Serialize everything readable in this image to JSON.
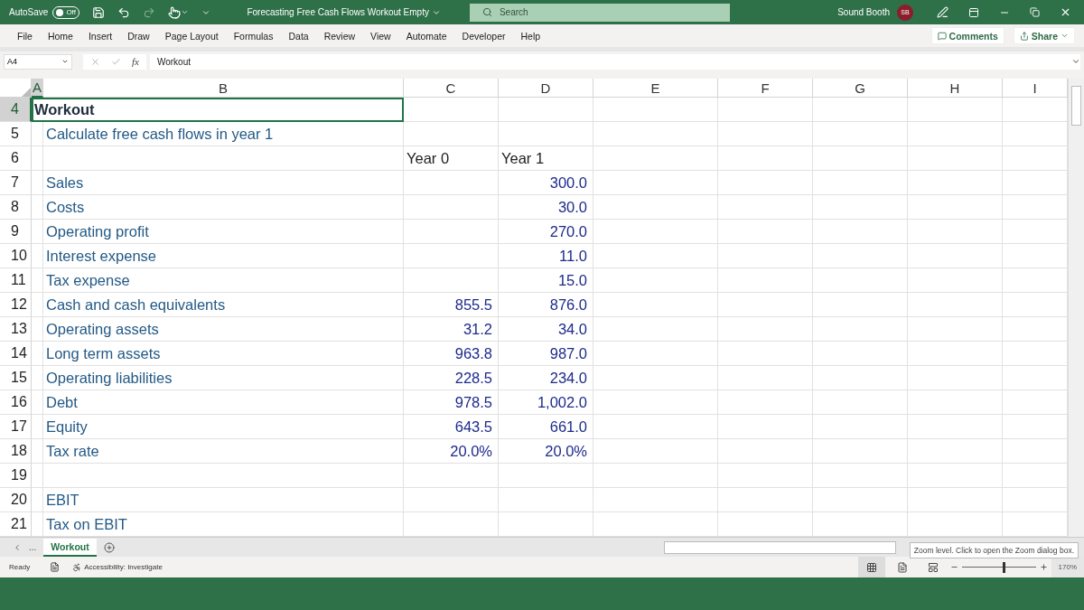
{
  "title_bar": {
    "autosave_label": "AutoSave",
    "autosave": {
      "on": false,
      "label": "Off"
    },
    "document_title": "Forecasting Free Cash Flows Workout Empty",
    "search_placeholder": "Search",
    "user_name": "Sound Booth",
    "user_initials": "SB"
  },
  "ribbon_tabs": [
    "File",
    "Home",
    "Insert",
    "Draw",
    "Page Layout",
    "Formulas",
    "Data",
    "Review",
    "View",
    "Automate",
    "Developer",
    "Help"
  ],
  "ribbon_buttons": {
    "comments": "Comments",
    "share": "Share"
  },
  "formula_bar": {
    "name_box": "A4",
    "fx": "fx",
    "value": "Workout"
  },
  "columns": [
    {
      "label": "A",
      "selected": true
    },
    {
      "label": "B",
      "selected": false
    },
    {
      "label": "C",
      "selected": false
    },
    {
      "label": "D",
      "selected": false
    },
    {
      "label": "E",
      "selected": false
    },
    {
      "label": "F",
      "selected": false
    },
    {
      "label": "G",
      "selected": false
    },
    {
      "label": "H",
      "selected": false
    },
    {
      "label": "I",
      "selected": false
    }
  ],
  "rows": [
    {
      "number": "4",
      "selected": true,
      "a": {
        "kind": "heading",
        "text": "Workout",
        "selected": true
      }
    },
    {
      "number": "5",
      "selected": false,
      "b": {
        "kind": "text",
        "text": "Calculate free cash flows in year 1",
        "selected": false
      }
    },
    {
      "number": "6",
      "selected": false,
      "c": {
        "kind": "plain",
        "text": "Year 0",
        "selected": false
      },
      "d": {
        "kind": "plain",
        "text": "Year 1",
        "selected": false
      }
    },
    {
      "number": "7",
      "selected": false,
      "b": {
        "kind": "text",
        "text": "Sales",
        "selected": false
      },
      "d": {
        "kind": "number",
        "text": "300.0",
        "selected": false
      }
    },
    {
      "number": "8",
      "selected": false,
      "b": {
        "kind": "text",
        "text": "Costs",
        "selected": false
      },
      "d": {
        "kind": "number",
        "text": "30.0",
        "selected": false
      }
    },
    {
      "number": "9",
      "selected": false,
      "b": {
        "kind": "text",
        "text": "Operating profit",
        "selected": false
      },
      "d": {
        "kind": "number",
        "text": "270.0",
        "selected": false
      }
    },
    {
      "number": "10",
      "selected": false,
      "b": {
        "kind": "text",
        "text": "Interest expense",
        "selected": false
      },
      "d": {
        "kind": "number",
        "text": "11.0",
        "selected": false
      }
    },
    {
      "number": "11",
      "selected": false,
      "b": {
        "kind": "text",
        "text": "Tax expense",
        "selected": false
      },
      "d": {
        "kind": "number",
        "text": "15.0",
        "selected": false
      }
    },
    {
      "number": "12",
      "selected": false,
      "b": {
        "kind": "text",
        "text": "Cash and cash equivalents",
        "selected": false
      },
      "c": {
        "kind": "number",
        "text": "855.5",
        "selected": false
      },
      "d": {
        "kind": "number",
        "text": "876.0",
        "selected": false
      }
    },
    {
      "number": "13",
      "selected": false,
      "b": {
        "kind": "text",
        "text": "Operating assets",
        "selected": false
      },
      "c": {
        "kind": "number",
        "text": "31.2",
        "selected": false
      },
      "d": {
        "kind": "number",
        "text": "34.0",
        "selected": false
      }
    },
    {
      "number": "14",
      "selected": false,
      "b": {
        "kind": "text",
        "text": "Long term assets",
        "selected": false
      },
      "c": {
        "kind": "number",
        "text": "963.8",
        "selected": false
      },
      "d": {
        "kind": "number",
        "text": "987.0",
        "selected": false
      }
    },
    {
      "number": "15",
      "selected": false,
      "b": {
        "kind": "text",
        "text": "Operating liabilities",
        "selected": false
      },
      "c": {
        "kind": "number",
        "text": "228.5",
        "selected": false
      },
      "d": {
        "kind": "number",
        "text": "234.0",
        "selected": false
      }
    },
    {
      "number": "16",
      "selected": false,
      "b": {
        "kind": "text",
        "text": "Debt",
        "selected": false
      },
      "c": {
        "kind": "number",
        "text": "978.5",
        "selected": false
      },
      "d": {
        "kind": "number",
        "text": "1,002.0",
        "selected": false
      }
    },
    {
      "number": "17",
      "selected": false,
      "b": {
        "kind": "text",
        "text": "Equity",
        "selected": false
      },
      "c": {
        "kind": "number",
        "text": "643.5",
        "selected": false
      },
      "d": {
        "kind": "number",
        "text": "661.0",
        "selected": false
      }
    },
    {
      "number": "18",
      "selected": false,
      "b": {
        "kind": "text",
        "text": "Tax rate",
        "selected": false
      },
      "c": {
        "kind": "number",
        "text": "20.0%",
        "selected": false
      },
      "d": {
        "kind": "number",
        "text": "20.0%",
        "selected": false
      }
    },
    {
      "number": "19",
      "selected": false
    },
    {
      "number": "20",
      "selected": false,
      "b": {
        "kind": "text",
        "text": "EBIT",
        "selected": false
      }
    },
    {
      "number": "21",
      "selected": false,
      "b": {
        "kind": "text",
        "text": "Tax on EBIT",
        "selected": false
      }
    }
  ],
  "sheet_tabs": {
    "more": "...",
    "tabs": [
      {
        "label": "Workout",
        "selected": true
      }
    ]
  },
  "tooltip": "Zoom level. Click to open the Zoom dialog box.",
  "status_bar": {
    "ready": "Ready",
    "accessibility": "Accessibility: Investigate",
    "zoom_slider": {
      "level": 0.57
    },
    "zoom": "170%"
  }
}
